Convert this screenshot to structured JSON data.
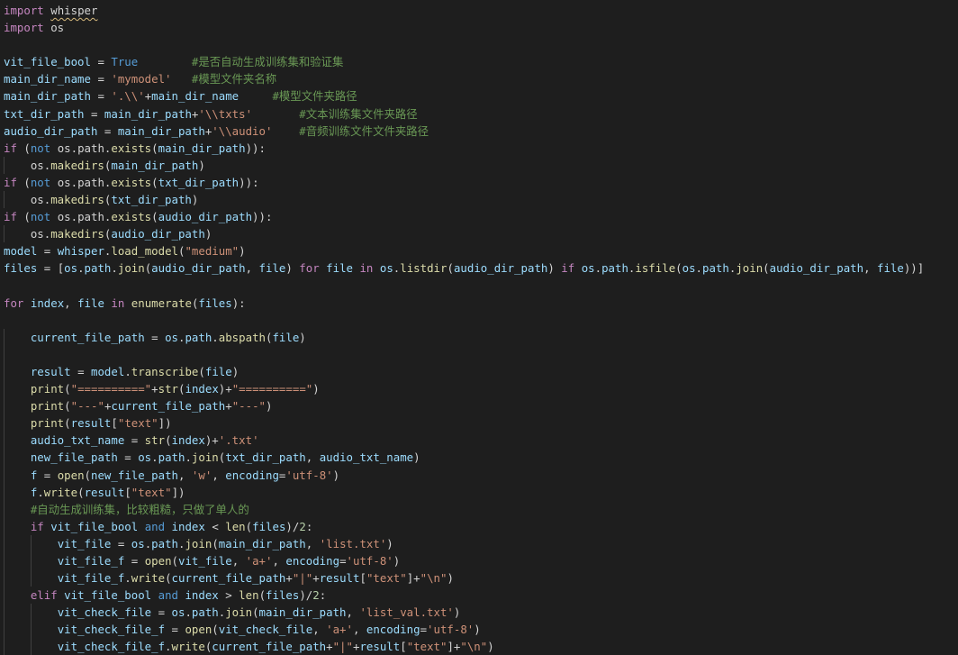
{
  "editor": {
    "language": "python",
    "theme": "dark",
    "colors": {
      "background": "#1e1e1e",
      "keyword": "#c586c0",
      "builtin_keyword": "#569cd6",
      "function": "#dcdcaa",
      "variable": "#9cdcfe",
      "string": "#ce9178",
      "comment": "#6a9955",
      "class": "#4ec9b0",
      "default": "#d4d4d4",
      "warning_squiggle": "#d7ba7d"
    },
    "lines": [
      [
        [
          "kw",
          "import"
        ],
        [
          "op",
          " "
        ],
        [
          "op",
          "whisper",
          "squiggle"
        ]
      ],
      [
        [
          "kw",
          "import"
        ],
        [
          "op",
          " os"
        ]
      ],
      [],
      [
        [
          "vr",
          "vit_file_bool"
        ],
        [
          "op",
          " = "
        ],
        [
          "bl",
          "True"
        ],
        [
          "op",
          "        "
        ],
        [
          "cm",
          "#是否自动生成训练集和验证集"
        ]
      ],
      [
        [
          "vr",
          "main_dir_name"
        ],
        [
          "op",
          " = "
        ],
        [
          "st",
          "'mymodel'"
        ],
        [
          "op",
          "   "
        ],
        [
          "cm",
          "#模型文件夹名称"
        ]
      ],
      [
        [
          "vr",
          "main_dir_path"
        ],
        [
          "op",
          " = "
        ],
        [
          "st",
          "'.\\\\'"
        ],
        [
          "op",
          "+"
        ],
        [
          "vr",
          "main_dir_name"
        ],
        [
          "op",
          "     "
        ],
        [
          "cm",
          "#模型文件夹路径"
        ]
      ],
      [
        [
          "vr",
          "txt_dir_path"
        ],
        [
          "op",
          " = "
        ],
        [
          "vr",
          "main_dir_path"
        ],
        [
          "op",
          "+"
        ],
        [
          "st",
          "'\\\\txts'"
        ],
        [
          "op",
          "       "
        ],
        [
          "cm",
          "#文本训练集文件夹路径"
        ]
      ],
      [
        [
          "vr",
          "audio_dir_path"
        ],
        [
          "op",
          " = "
        ],
        [
          "vr",
          "main_dir_path"
        ],
        [
          "op",
          "+"
        ],
        [
          "st",
          "'\\\\audio'"
        ],
        [
          "op",
          "    "
        ],
        [
          "cm",
          "#音频训练文件文件夹路径"
        ]
      ],
      [
        [
          "kw",
          "if"
        ],
        [
          "op",
          " ("
        ],
        [
          "bl",
          "not"
        ],
        [
          "op",
          " os.path."
        ],
        [
          "fn",
          "exists"
        ],
        [
          "op",
          "("
        ],
        [
          "vr",
          "main_dir_path"
        ],
        [
          "op",
          "))"
        ],
        [
          "op",
          ":"
        ]
      ],
      [
        [
          "op",
          "    os."
        ],
        [
          "fn",
          "makedirs"
        ],
        [
          "op",
          "("
        ],
        [
          "vr",
          "main_dir_path"
        ],
        [
          "op",
          ")"
        ]
      ],
      [
        [
          "kw",
          "if"
        ],
        [
          "op",
          " ("
        ],
        [
          "bl",
          "not"
        ],
        [
          "op",
          " os.path."
        ],
        [
          "fn",
          "exists"
        ],
        [
          "op",
          "("
        ],
        [
          "vr",
          "txt_dir_path"
        ],
        [
          "op",
          "))"
        ],
        [
          "op",
          ":"
        ]
      ],
      [
        [
          "op",
          "    os."
        ],
        [
          "fn",
          "makedirs"
        ],
        [
          "op",
          "("
        ],
        [
          "vr",
          "txt_dir_path"
        ],
        [
          "op",
          ")"
        ]
      ],
      [
        [
          "kw",
          "if"
        ],
        [
          "op",
          " ("
        ],
        [
          "bl",
          "not"
        ],
        [
          "op",
          " os.path."
        ],
        [
          "fn",
          "exists"
        ],
        [
          "op",
          "("
        ],
        [
          "vr",
          "audio_dir_path"
        ],
        [
          "op",
          "))"
        ],
        [
          "op",
          ":"
        ]
      ],
      [
        [
          "op",
          "    os."
        ],
        [
          "fn",
          "makedirs"
        ],
        [
          "op",
          "("
        ],
        [
          "vr",
          "audio_dir_path"
        ],
        [
          "op",
          ")"
        ]
      ],
      [
        [
          "vr",
          "model"
        ],
        [
          "op",
          " = "
        ],
        [
          "vr",
          "whisper"
        ],
        [
          "op",
          "."
        ],
        [
          "fn",
          "load_model"
        ],
        [
          "op",
          "("
        ],
        [
          "st",
          "\"medium\""
        ],
        [
          "op",
          ")"
        ]
      ],
      [
        [
          "vr",
          "files"
        ],
        [
          "op",
          " = ["
        ],
        [
          "vr",
          "os"
        ],
        [
          "op",
          "."
        ],
        [
          "vr",
          "path"
        ],
        [
          "op",
          "."
        ],
        [
          "fn",
          "join"
        ],
        [
          "op",
          "("
        ],
        [
          "vr",
          "audio_dir_path"
        ],
        [
          "op",
          ", "
        ],
        [
          "vr",
          "file"
        ],
        [
          "op",
          ") "
        ],
        [
          "kw",
          "for"
        ],
        [
          "op",
          " "
        ],
        [
          "vr",
          "file"
        ],
        [
          "op",
          " "
        ],
        [
          "kw",
          "in"
        ],
        [
          "op",
          " "
        ],
        [
          "vr",
          "os"
        ],
        [
          "op",
          "."
        ],
        [
          "fn",
          "listdir"
        ],
        [
          "op",
          "("
        ],
        [
          "vr",
          "audio_dir_path"
        ],
        [
          "op",
          ") "
        ],
        [
          "kw",
          "if"
        ],
        [
          "op",
          " "
        ],
        [
          "vr",
          "os"
        ],
        [
          "op",
          "."
        ],
        [
          "vr",
          "path"
        ],
        [
          "op",
          "."
        ],
        [
          "fn",
          "isfile"
        ],
        [
          "op",
          "("
        ],
        [
          "vr",
          "os"
        ],
        [
          "op",
          "."
        ],
        [
          "vr",
          "path"
        ],
        [
          "op",
          "."
        ],
        [
          "fn",
          "join"
        ],
        [
          "op",
          "("
        ],
        [
          "vr",
          "audio_dir_path"
        ],
        [
          "op",
          ", "
        ],
        [
          "vr",
          "file"
        ],
        [
          "op",
          "))]"
        ]
      ],
      [],
      [
        [
          "kw",
          "for"
        ],
        [
          "op",
          " "
        ],
        [
          "vr",
          "index"
        ],
        [
          "op",
          ", "
        ],
        [
          "vr",
          "file"
        ],
        [
          "op",
          " "
        ],
        [
          "kw",
          "in"
        ],
        [
          "op",
          " "
        ],
        [
          "fn",
          "enumerate"
        ],
        [
          "op",
          "("
        ],
        [
          "vr",
          "files"
        ],
        [
          "op",
          "):"
        ]
      ],
      [],
      [
        [
          "op",
          "    "
        ],
        [
          "vr",
          "current_file_path"
        ],
        [
          "op",
          " = "
        ],
        [
          "vr",
          "os"
        ],
        [
          "op",
          "."
        ],
        [
          "vr",
          "path"
        ],
        [
          "op",
          "."
        ],
        [
          "fn",
          "abspath"
        ],
        [
          "op",
          "("
        ],
        [
          "vr",
          "file"
        ],
        [
          "op",
          ")"
        ]
      ],
      [],
      [
        [
          "op",
          "    "
        ],
        [
          "vr",
          "result"
        ],
        [
          "op",
          " = "
        ],
        [
          "vr",
          "model"
        ],
        [
          "op",
          "."
        ],
        [
          "fn",
          "transcribe"
        ],
        [
          "op",
          "("
        ],
        [
          "vr",
          "file"
        ],
        [
          "op",
          ")"
        ]
      ],
      [
        [
          "op",
          "    "
        ],
        [
          "fn",
          "print"
        ],
        [
          "op",
          "("
        ],
        [
          "st",
          "\"==========\""
        ],
        [
          "op",
          "+"
        ],
        [
          "fn",
          "str"
        ],
        [
          "op",
          "("
        ],
        [
          "vr",
          "index"
        ],
        [
          "op",
          ")+"
        ],
        [
          "st",
          "\"==========\""
        ],
        [
          "op",
          ")"
        ]
      ],
      [
        [
          "op",
          "    "
        ],
        [
          "fn",
          "print"
        ],
        [
          "op",
          "("
        ],
        [
          "st",
          "\"---\""
        ],
        [
          "op",
          "+"
        ],
        [
          "vr",
          "current_file_path"
        ],
        [
          "op",
          "+"
        ],
        [
          "st",
          "\"---\""
        ],
        [
          "op",
          ")"
        ]
      ],
      [
        [
          "op",
          "    "
        ],
        [
          "fn",
          "print"
        ],
        [
          "op",
          "("
        ],
        [
          "vr",
          "result"
        ],
        [
          "op",
          "["
        ],
        [
          "st",
          "\"text\""
        ],
        [
          "op",
          "])"
        ]
      ],
      [
        [
          "op",
          "    "
        ],
        [
          "vr",
          "audio_txt_name"
        ],
        [
          "op",
          " = "
        ],
        [
          "fn",
          "str"
        ],
        [
          "op",
          "("
        ],
        [
          "vr",
          "index"
        ],
        [
          "op",
          ")+"
        ],
        [
          "st",
          "'.txt'"
        ]
      ],
      [
        [
          "op",
          "    "
        ],
        [
          "vr",
          "new_file_path"
        ],
        [
          "op",
          " = "
        ],
        [
          "vr",
          "os"
        ],
        [
          "op",
          "."
        ],
        [
          "vr",
          "path"
        ],
        [
          "op",
          "."
        ],
        [
          "fn",
          "join"
        ],
        [
          "op",
          "("
        ],
        [
          "vr",
          "txt_dir_path"
        ],
        [
          "op",
          ", "
        ],
        [
          "vr",
          "audio_txt_name"
        ],
        [
          "op",
          ")"
        ]
      ],
      [
        [
          "op",
          "    "
        ],
        [
          "vr",
          "f"
        ],
        [
          "op",
          " = "
        ],
        [
          "fn",
          "open"
        ],
        [
          "op",
          "("
        ],
        [
          "vr",
          "new_file_path"
        ],
        [
          "op",
          ", "
        ],
        [
          "st",
          "'w'"
        ],
        [
          "op",
          ", "
        ],
        [
          "vr",
          "encoding"
        ],
        [
          "op",
          "="
        ],
        [
          "st",
          "'utf-8'"
        ],
        [
          "op",
          ")"
        ]
      ],
      [
        [
          "op",
          "    "
        ],
        [
          "vr",
          "f"
        ],
        [
          "op",
          "."
        ],
        [
          "fn",
          "write"
        ],
        [
          "op",
          "("
        ],
        [
          "vr",
          "result"
        ],
        [
          "op",
          "["
        ],
        [
          "st",
          "\"text\""
        ],
        [
          "op",
          "])"
        ]
      ],
      [
        [
          "op",
          "    "
        ],
        [
          "cm",
          "#自动生成训练集，比较粗糙，只做了单人的"
        ]
      ],
      [
        [
          "op",
          "    "
        ],
        [
          "kw",
          "if"
        ],
        [
          "op",
          " "
        ],
        [
          "vr",
          "vit_file_bool"
        ],
        [
          "op",
          " "
        ],
        [
          "bl",
          "and"
        ],
        [
          "op",
          " "
        ],
        [
          "vr",
          "index"
        ],
        [
          "op",
          " < "
        ],
        [
          "fn",
          "len"
        ],
        [
          "op",
          "("
        ],
        [
          "vr",
          "files"
        ],
        [
          "op",
          ")/"
        ],
        [
          "nm",
          "2"
        ],
        [
          "op",
          ":"
        ]
      ],
      [
        [
          "op",
          "        "
        ],
        [
          "vr",
          "vit_file"
        ],
        [
          "op",
          " = "
        ],
        [
          "vr",
          "os"
        ],
        [
          "op",
          "."
        ],
        [
          "vr",
          "path"
        ],
        [
          "op",
          "."
        ],
        [
          "fn",
          "join"
        ],
        [
          "op",
          "("
        ],
        [
          "vr",
          "main_dir_path"
        ],
        [
          "op",
          ", "
        ],
        [
          "st",
          "'list.txt'"
        ],
        [
          "op",
          ")"
        ]
      ],
      [
        [
          "op",
          "        "
        ],
        [
          "vr",
          "vit_file_f"
        ],
        [
          "op",
          " = "
        ],
        [
          "fn",
          "open"
        ],
        [
          "op",
          "("
        ],
        [
          "vr",
          "vit_file"
        ],
        [
          "op",
          ", "
        ],
        [
          "st",
          "'a+'"
        ],
        [
          "op",
          ", "
        ],
        [
          "vr",
          "encoding"
        ],
        [
          "op",
          "="
        ],
        [
          "st",
          "'utf-8'"
        ],
        [
          "op",
          ")"
        ]
      ],
      [
        [
          "op",
          "        "
        ],
        [
          "vr",
          "vit_file_f"
        ],
        [
          "op",
          "."
        ],
        [
          "fn",
          "write"
        ],
        [
          "op",
          "("
        ],
        [
          "vr",
          "current_file_path"
        ],
        [
          "op",
          "+"
        ],
        [
          "st",
          "\"|\""
        ],
        [
          "op",
          "+"
        ],
        [
          "vr",
          "result"
        ],
        [
          "op",
          "["
        ],
        [
          "st",
          "\"text\""
        ],
        [
          "op",
          "]+"
        ],
        [
          "st",
          "\"\\n\""
        ],
        [
          "op",
          ")"
        ]
      ],
      [
        [
          "op",
          "    "
        ],
        [
          "kw",
          "elif"
        ],
        [
          "op",
          " "
        ],
        [
          "vr",
          "vit_file_bool"
        ],
        [
          "op",
          " "
        ],
        [
          "bl",
          "and"
        ],
        [
          "op",
          " "
        ],
        [
          "vr",
          "index"
        ],
        [
          "op",
          " > "
        ],
        [
          "fn",
          "len"
        ],
        [
          "op",
          "("
        ],
        [
          "vr",
          "files"
        ],
        [
          "op",
          ")/"
        ],
        [
          "nm",
          "2"
        ],
        [
          "op",
          ":"
        ]
      ],
      [
        [
          "op",
          "        "
        ],
        [
          "vr",
          "vit_check_file"
        ],
        [
          "op",
          " = "
        ],
        [
          "vr",
          "os"
        ],
        [
          "op",
          "."
        ],
        [
          "vr",
          "path"
        ],
        [
          "op",
          "."
        ],
        [
          "fn",
          "join"
        ],
        [
          "op",
          "("
        ],
        [
          "vr",
          "main_dir_path"
        ],
        [
          "op",
          ", "
        ],
        [
          "st",
          "'list_val.txt'"
        ],
        [
          "op",
          ")"
        ]
      ],
      [
        [
          "op",
          "        "
        ],
        [
          "vr",
          "vit_check_file_f"
        ],
        [
          "op",
          " = "
        ],
        [
          "fn",
          "open"
        ],
        [
          "op",
          "("
        ],
        [
          "vr",
          "vit_check_file"
        ],
        [
          "op",
          ", "
        ],
        [
          "st",
          "'a+'"
        ],
        [
          "op",
          ", "
        ],
        [
          "vr",
          "encoding"
        ],
        [
          "op",
          "="
        ],
        [
          "st",
          "'utf-8'"
        ],
        [
          "op",
          ")"
        ]
      ],
      [
        [
          "op",
          "        "
        ],
        [
          "vr",
          "vit_check_file_f"
        ],
        [
          "op",
          "."
        ],
        [
          "fn",
          "write"
        ],
        [
          "op",
          "("
        ],
        [
          "vr",
          "current_file_path"
        ],
        [
          "op",
          "+"
        ],
        [
          "st",
          "\"|\""
        ],
        [
          "op",
          "+"
        ],
        [
          "vr",
          "result"
        ],
        [
          "op",
          "["
        ],
        [
          "st",
          "\"text\""
        ],
        [
          "op",
          "]+"
        ],
        [
          "st",
          "\"\\n\""
        ],
        [
          "op",
          ")"
        ]
      ]
    ]
  }
}
